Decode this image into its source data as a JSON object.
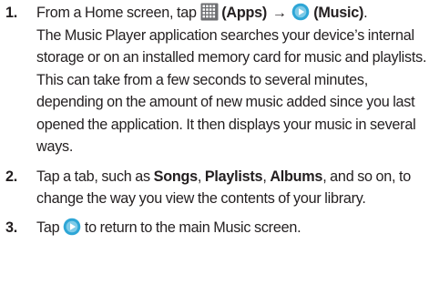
{
  "steps": [
    {
      "number": "1.",
      "parts": {
        "p1": "From a Home screen, tap ",
        "apps_label": "(Apps)",
        "arrow": "→",
        "music_label": "(Music)",
        "p2": ".",
        "body": "The Music Player application searches your device’s internal storage or on an installed memory card for music and playlists. This can take from a few seconds to several minutes, depending on the amount of new music added since you last opened the application. It then displays your music in several ways."
      }
    },
    {
      "number": "2.",
      "parts": {
        "p1": "Tap a tab, such as ",
        "songs": "Songs",
        "sep1": ", ",
        "playlists": "Playlists",
        "sep2": ", ",
        "albums": "Albums",
        "p2": ", and so on, to change the way you view the contents of your library."
      }
    },
    {
      "number": "3.",
      "parts": {
        "p1": "Tap ",
        "p2": " to return to the main Music screen."
      }
    }
  ],
  "icons": {
    "apps": "apps-grid-icon",
    "music": "music-play-icon",
    "music_color": "#2ea6d6",
    "apps_color": "#6d6e71"
  }
}
